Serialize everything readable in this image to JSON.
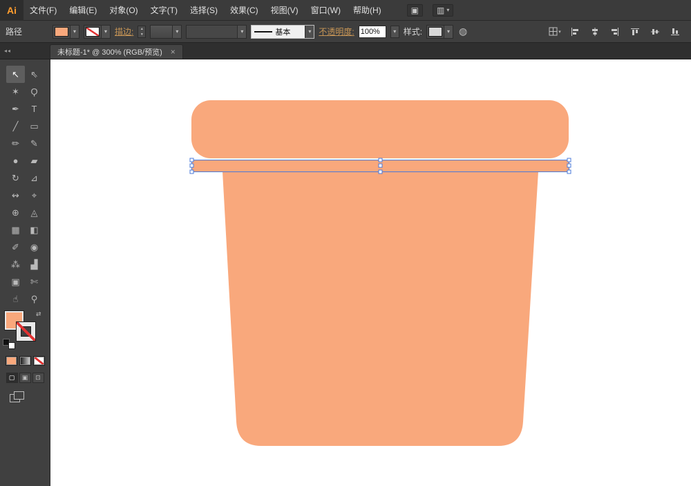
{
  "colors": {
    "shape_fill": "#F9A87C",
    "selection_blue": "#4A78D8",
    "link_text": "#C79556",
    "none_red": "#E23333"
  },
  "icons": {
    "chevron_down": "▾",
    "stepper_up": "▲",
    "stepper_down": "▼",
    "swap": "⇄",
    "collapse": "◂◂",
    "globe": "◍"
  },
  "menubar": {
    "logo": "Ai",
    "items": [
      "文件(F)",
      "编辑(E)",
      "对象(O)",
      "文字(T)",
      "选择(S)",
      "效果(C)",
      "视图(V)",
      "窗口(W)",
      "帮助(H)"
    ],
    "right_icons": [
      {
        "name": "app-bar-icon",
        "glyph": "▣"
      },
      {
        "name": "arrange-documents-icon",
        "glyph": "▥"
      }
    ]
  },
  "controlbar": {
    "context_label": "路径",
    "stroke_label": "描边:",
    "stroke_style": "基本",
    "opacity_label": "不透明度:",
    "opacity_value": "100%",
    "style_label": "样式:"
  },
  "tabbar": {
    "title": "未标题-1* @ 300% (RGB/预览)",
    "close": "×"
  },
  "toolbar": {
    "tools": [
      {
        "name": "selection-tool",
        "glyph": "↖"
      },
      {
        "name": "direct-selection-tool",
        "glyph": "⇖"
      },
      {
        "name": "magic-wand-tool",
        "glyph": "✶"
      },
      {
        "name": "lasso-tool",
        "glyph": "Ϙ"
      },
      {
        "name": "pen-tool",
        "glyph": "✒"
      },
      {
        "name": "type-tool",
        "glyph": "T"
      },
      {
        "name": "line-segment-tool",
        "glyph": "╱"
      },
      {
        "name": "rectangle-tool",
        "glyph": "▭"
      },
      {
        "name": "paintbrush-tool",
        "glyph": "✏"
      },
      {
        "name": "pencil-tool",
        "glyph": "✎"
      },
      {
        "name": "blob-brush-tool",
        "glyph": "●"
      },
      {
        "name": "eraser-tool",
        "glyph": "▰"
      },
      {
        "name": "rotate-tool",
        "glyph": "↻"
      },
      {
        "name": "scale-tool",
        "glyph": "⊿"
      },
      {
        "name": "width-tool",
        "glyph": "↭"
      },
      {
        "name": "free-transform-tool",
        "glyph": "⌖"
      },
      {
        "name": "shape-builder-tool",
        "glyph": "⊕"
      },
      {
        "name": "perspective-grid-tool",
        "glyph": "◬"
      },
      {
        "name": "mesh-tool",
        "glyph": "▦"
      },
      {
        "name": "gradient-tool",
        "glyph": "◧"
      },
      {
        "name": "eyedropper-tool",
        "glyph": "✐"
      },
      {
        "name": "blend-tool",
        "glyph": "◉"
      },
      {
        "name": "symbol-sprayer-tool",
        "glyph": "⁂"
      },
      {
        "name": "column-graph-tool",
        "glyph": "▟"
      },
      {
        "name": "artboard-tool",
        "glyph": "▣"
      },
      {
        "name": "slice-tool",
        "glyph": "✄"
      },
      {
        "name": "hand-tool",
        "glyph": "☝"
      },
      {
        "name": "zoom-tool",
        "glyph": "⚲"
      }
    ],
    "drawing_modes": [
      "▢",
      "▣",
      "⊡"
    ]
  }
}
